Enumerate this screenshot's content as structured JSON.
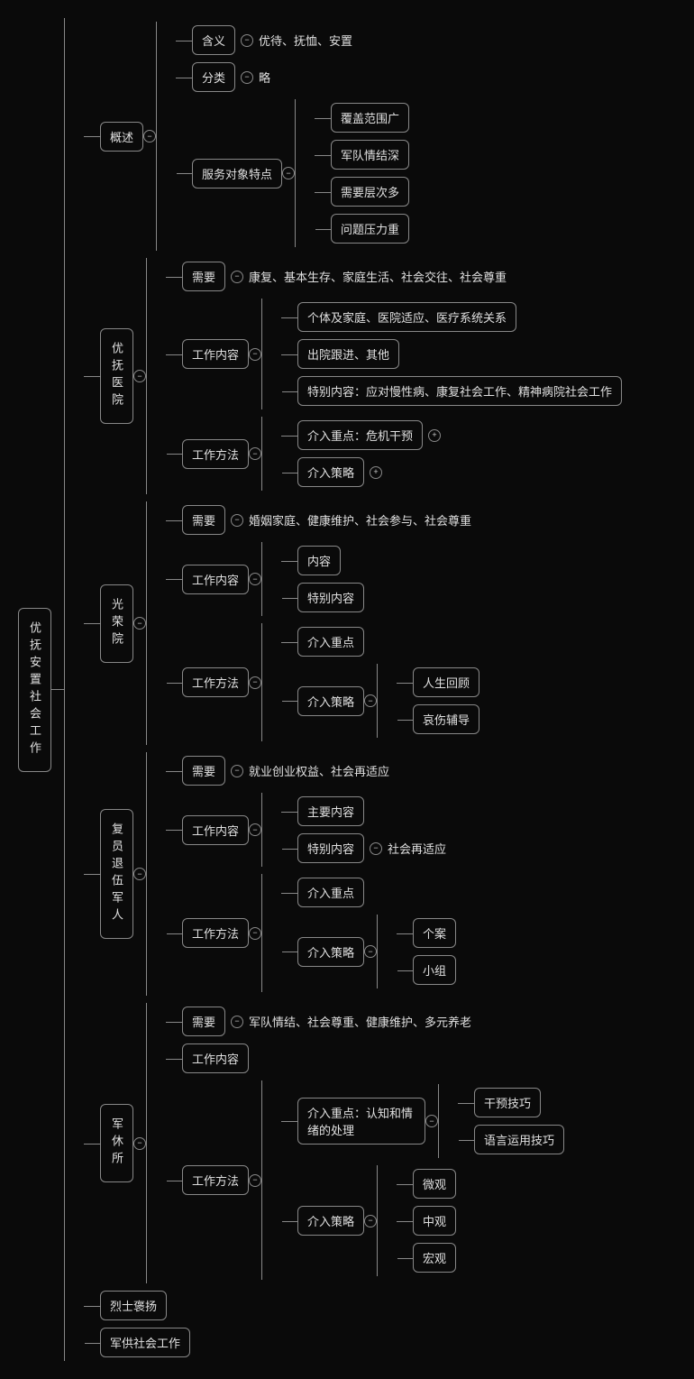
{
  "root": "优抚安置社会工作",
  "s1": {
    "title": "概述",
    "a": {
      "label": "含义",
      "val": "优待、抚恤、安置"
    },
    "b": {
      "label": "分类",
      "val": "略"
    },
    "c": {
      "label": "服务对象特点",
      "i1": "覆盖范围广",
      "i2": "军队情结深",
      "i3": "需要层次多",
      "i4": "问题压力重"
    }
  },
  "s2": {
    "title": "优抚医院",
    "need": {
      "label": "需要",
      "val": "康复、基本生存、家庭生活、社会交往、社会尊重"
    },
    "content": {
      "label": "工作内容",
      "i1": "个体及家庭、医院适应、医疗系统关系",
      "i2": "出院跟进、其他",
      "i3": "特别内容：应对慢性病、康复社会工作、精神病院社会工作"
    },
    "method": {
      "label": "工作方法",
      "i1": "介入重点：危机干预",
      "i2": "介入策略"
    }
  },
  "s3": {
    "title": "光荣院",
    "need": {
      "label": "需要",
      "val": "婚姻家庭、健康维护、社会参与、社会尊重"
    },
    "content": {
      "label": "工作内容",
      "i1": "内容",
      "i2": "特别内容"
    },
    "method": {
      "label": "工作方法",
      "i1": "介入重点",
      "strat": {
        "label": "介入策略",
        "a": "人生回顾",
        "b": "哀伤辅导"
      }
    }
  },
  "s4": {
    "title": "复员退伍军人",
    "need": {
      "label": "需要",
      "val": "就业创业权益、社会再适应"
    },
    "content": {
      "label": "工作内容",
      "i1": "主要内容",
      "sp": {
        "label": "特别内容",
        "val": "社会再适应"
      }
    },
    "method": {
      "label": "工作方法",
      "i1": "介入重点",
      "strat": {
        "label": "介入策略",
        "a": "个案",
        "b": "小组"
      }
    }
  },
  "s5": {
    "title": "军休所",
    "need": {
      "label": "需要",
      "val": "军队情结、社会尊重、健康维护、多元养老"
    },
    "content": {
      "label": "工作内容"
    },
    "method": {
      "label": "工作方法",
      "focus": {
        "label": "介入重点：认知和情绪的处理",
        "a": "干预技巧",
        "b": "语言运用技巧"
      },
      "strat": {
        "label": "介入策略",
        "a": "微观",
        "b": "中观",
        "c": "宏观"
      }
    }
  },
  "s6": {
    "title": "烈士褒扬"
  },
  "s7": {
    "title": "军供社会工作"
  }
}
